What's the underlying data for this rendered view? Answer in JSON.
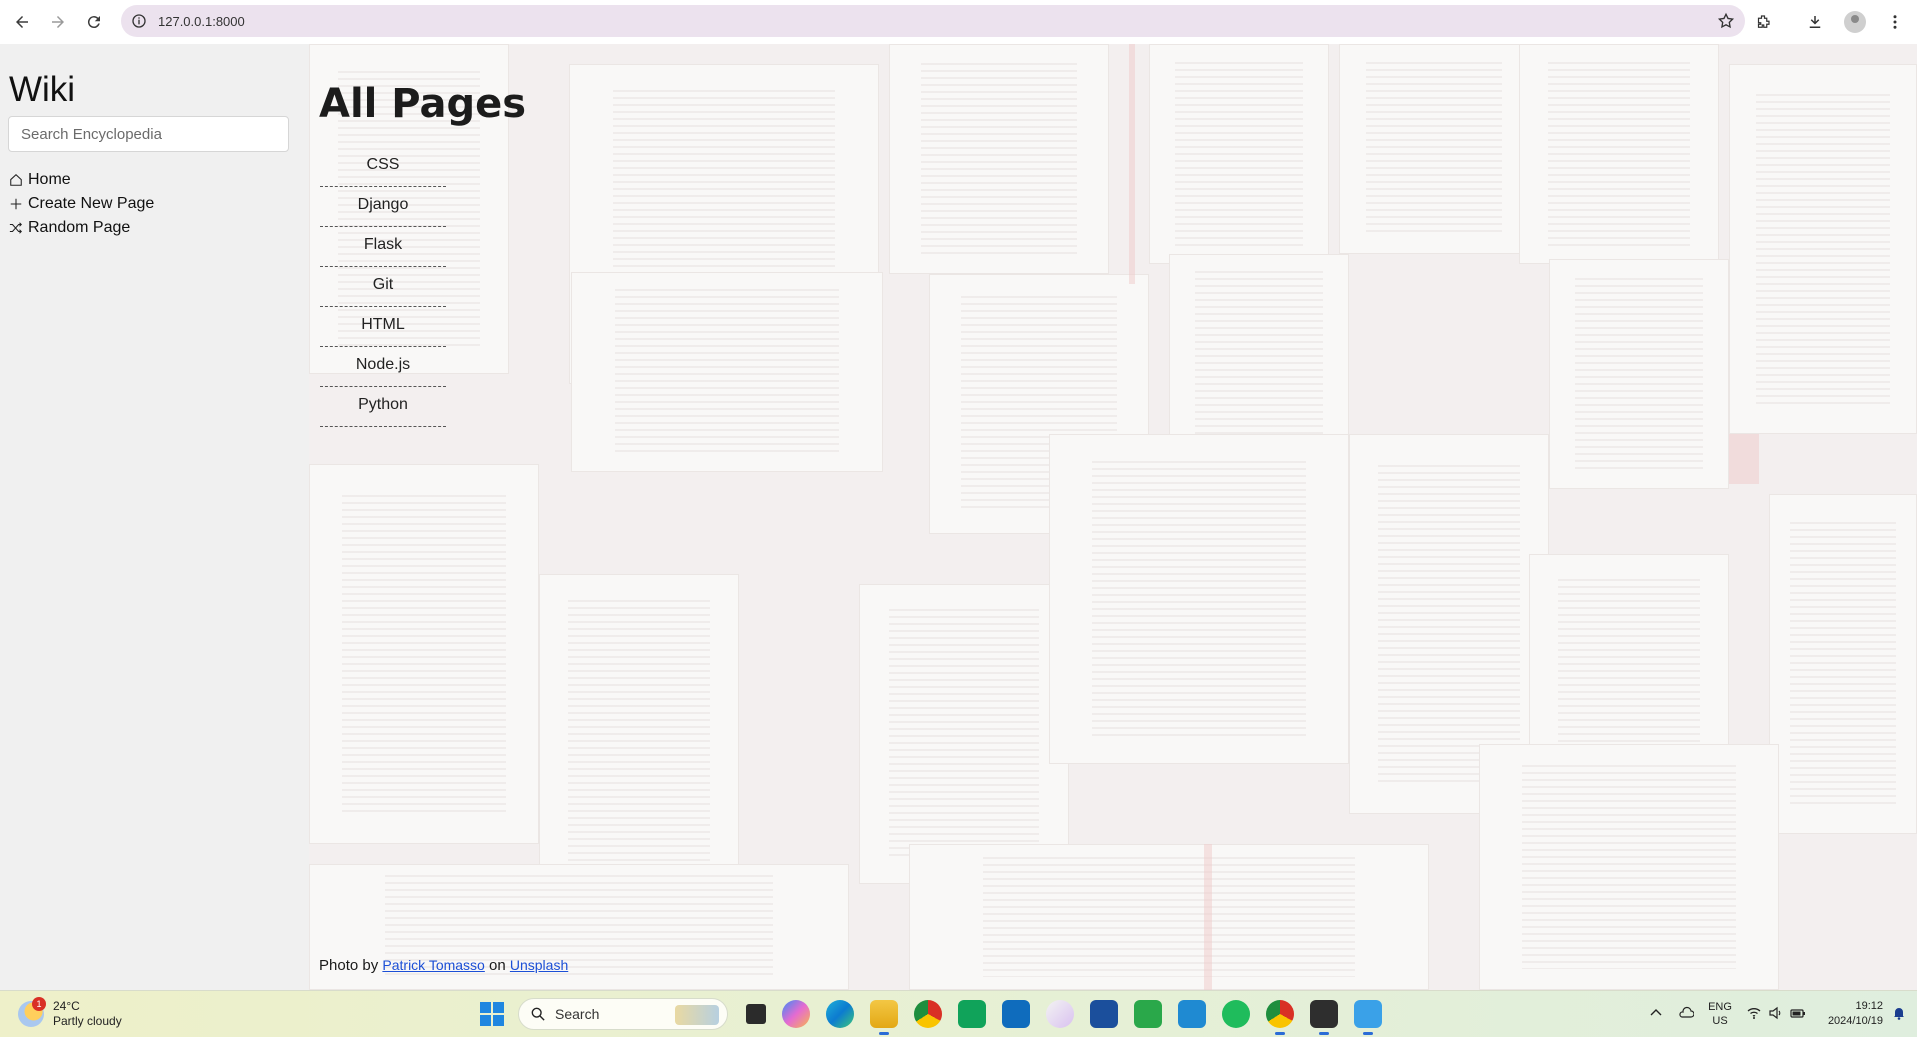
{
  "browser": {
    "url": "127.0.0.1:8000",
    "icons": [
      "back-icon",
      "forward-icon",
      "reload-icon",
      "site-info-icon",
      "bookmark-star-icon",
      "extensions-icon",
      "downloads-icon",
      "profile-avatar",
      "menu-icon"
    ]
  },
  "sidebar": {
    "title": "Wiki",
    "search_placeholder": "Search Encyclopedia",
    "links": [
      {
        "label": "Home",
        "icon": "home-icon"
      },
      {
        "label": "Create New Page",
        "icon": "plus-icon"
      },
      {
        "label": "Random Page",
        "icon": "shuffle-icon"
      }
    ]
  },
  "main": {
    "heading": "All Pages",
    "pages": [
      "CSS",
      "Django",
      "Flask",
      "Git",
      "HTML",
      "Node.js",
      "Python"
    ],
    "credit": {
      "prefix": "Photo by",
      "author": "Patrick Tomasso",
      "middle": "on",
      "site": "Unsplash"
    }
  },
  "taskbar": {
    "weather_temp": "24°C",
    "weather_desc": "Partly cloudy",
    "weather_badge": "1",
    "search_label": "Search",
    "lang_top": "ENG",
    "lang_bottom": "US",
    "time": "19:12",
    "date": "2024/10/19"
  },
  "colors": {
    "sidebar_bg": "#f0f0f0",
    "omnibox_bg": "#ece2ee",
    "link_blue": "#1c4fd6"
  }
}
